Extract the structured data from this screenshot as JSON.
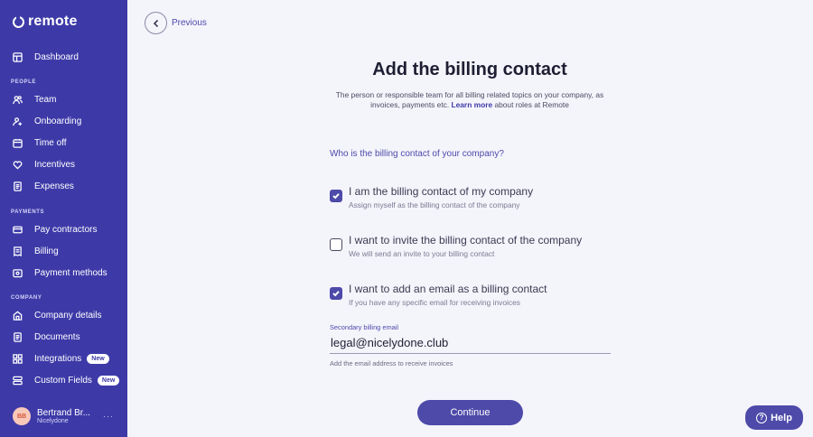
{
  "app": {
    "logo_text": "remote"
  },
  "sidebar": {
    "dashboard": {
      "label": "Dashboard",
      "icon": "dashboard-icon"
    },
    "sections": {
      "people": "PEOPLE",
      "payments": "PAYMENTS",
      "company": "COMPANY"
    },
    "people_items": [
      {
        "label": "Team",
        "icon": "team-icon"
      },
      {
        "label": "Onboarding",
        "icon": "onboarding-icon"
      },
      {
        "label": "Time off",
        "icon": "calendar-icon"
      },
      {
        "label": "Incentives",
        "icon": "heart-icon"
      },
      {
        "label": "Expenses",
        "icon": "document-icon"
      }
    ],
    "payments_items": [
      {
        "label": "Pay contractors",
        "icon": "card-icon"
      },
      {
        "label": "Billing",
        "icon": "receipt-icon"
      },
      {
        "label": "Payment methods",
        "icon": "wallet-icon"
      }
    ],
    "company_items": [
      {
        "label": "Company details",
        "icon": "building-icon"
      },
      {
        "label": "Documents",
        "icon": "document-icon"
      },
      {
        "label": "Integrations",
        "icon": "grid-icon",
        "badge": "New"
      },
      {
        "label": "Custom Fields",
        "icon": "fields-icon",
        "badge": "New"
      }
    ],
    "profile": {
      "initials": "BB",
      "name": "Bertrand Br...",
      "company": "Nicelydone",
      "more": "···"
    }
  },
  "nav": {
    "previous_label": "Previous"
  },
  "main": {
    "title": "Add the billing contact",
    "subtitle_before": "The person or responsible team for all billing related topics on your company, as invoices, payments etc.",
    "learn_more": "Learn more",
    "subtitle_after": "about roles at Remote",
    "question": "Who is the billing contact of your company?",
    "options": [
      {
        "label": "I am the billing contact of my company",
        "sub": "Assign myself as the billing contact of the company",
        "checked": true
      },
      {
        "label": "I want to invite the billing contact of the company",
        "sub": "We will send an invite to your billing contact",
        "checked": false
      },
      {
        "label": "I want to add an email as a billing contact",
        "sub": "If you have any specific email for receiving invoices",
        "checked": true
      }
    ],
    "secondary_email": {
      "label": "Secondary billing email",
      "value": "legal@nicelydone.club",
      "help": "Add the email address to receive invoices"
    },
    "continue_label": "Continue"
  },
  "help": {
    "label": "Help"
  },
  "colors": {
    "sidebar": "#3d3aa8",
    "accent": "#4d4aa9",
    "background": "#f4f4fb"
  }
}
